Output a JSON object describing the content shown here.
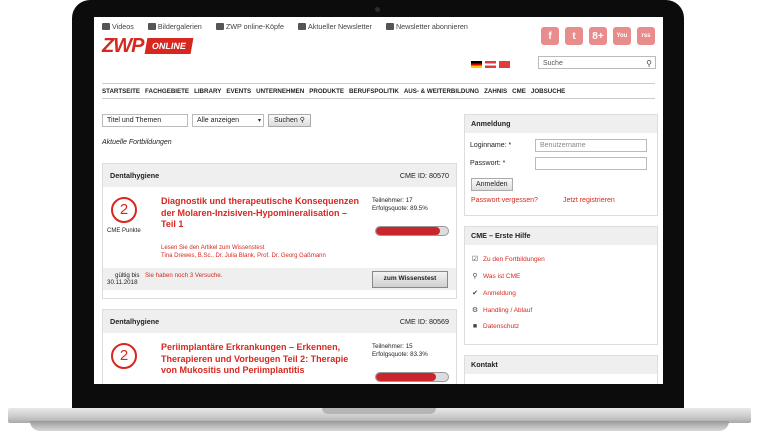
{
  "topbar": {
    "items": [
      "Videos",
      "Bildergalerien",
      "ZWP online-Köpfe",
      "Aktueller Newsletter",
      "Newsletter abonnieren"
    ]
  },
  "logo": {
    "main": "ZWP",
    "sub": "ONLINE"
  },
  "social": [
    "f",
    "t",
    "8+",
    "You",
    "rss"
  ],
  "search": {
    "placeholder": "Suche"
  },
  "nav": [
    "STARTSEITE",
    "FACHGEBIETE",
    "LIBRARY",
    "EVENTS",
    "UNTERNEHMEN",
    "PRODUKTE",
    "BERUFSPOLITIK",
    "AUS- & WEITERBILDUNG",
    "ZAHNIS",
    "CME",
    "JOBSUCHE"
  ],
  "filter": {
    "topic": "Titel und Themen",
    "select": "Alle anzeigen",
    "button": "Suchen"
  },
  "section_label": "Aktuelle Fortbildungen",
  "cards": [
    {
      "category": "Dentalhygiene",
      "cme_id": "CME ID: 80570",
      "points": "2",
      "points_label": "CME Punkte",
      "title": "Diagnostik und therapeutische Konsequenzen der Molaren-Inzisiven-Hypomineralisation – Teil 1",
      "participants": "Teilnehmer: 17",
      "success": "Erfolgsquote: 89.5%",
      "success_value": 0.895,
      "link": "Lesen Sie den Artikel zum Wissenstest",
      "authors": "Tina Drewes, B.Sc., Dr. Julia Blank, Prof. Dr. Georg Gaßmann",
      "valid_label": "gültig bis",
      "valid_date": "30.11.2018",
      "attempts": "Sie haben noch 3 Versuche.",
      "test_button": "zum Wissenstest"
    },
    {
      "category": "Dentalhygiene",
      "cme_id": "CME ID: 80569",
      "points": "2",
      "title": "Periimplantäre Erkrankungen – Erkennen, Therapieren und Vorbeugen Teil 2: Therapie von Mukositis und Periimplantitis",
      "participants": "Teilnehmer: 15",
      "success": "Erfolgsquote: 83.3%",
      "success_value": 0.833
    }
  ],
  "login": {
    "header": "Anmeldung",
    "login_label": "Loginname: *",
    "login_placeholder": "Benutzername",
    "password_label": "Passwort: *",
    "button": "Anmelden",
    "forgot": "Passwort vergessen?",
    "register": "Jetzt registrieren"
  },
  "help": {
    "header": "CME – Erste Hilfe",
    "items": [
      "Zu den Fortbildungen",
      "Was ist CME",
      "Anmeldung",
      "Handling / Ablauf",
      "Datenschutz"
    ]
  },
  "contact": {
    "header": "Kontakt"
  }
}
